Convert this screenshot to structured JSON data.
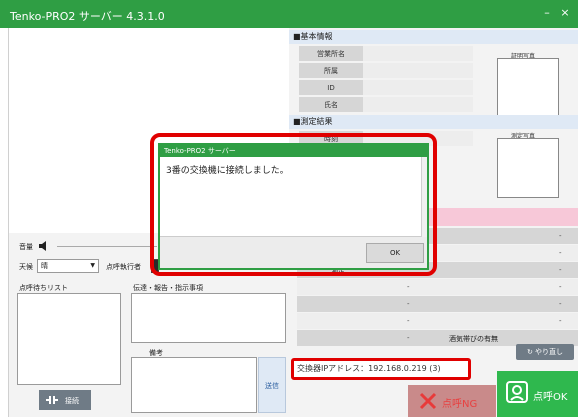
{
  "window": {
    "title": "Tenko-PRO2 サーバー 4.3.1.0",
    "minimize_label": "–",
    "close_label": "×"
  },
  "basic_info": {
    "section_label": "■基本情報",
    "labels": [
      "営業所名",
      "所属",
      "ID",
      "氏名"
    ],
    "photo_label": "証明写真"
  },
  "measurement": {
    "section_label": "■測定結果",
    "row_label": "時刻",
    "photo_label": "測定写真"
  },
  "results_grid": {
    "dashes": [
      "-",
      "-",
      "-",
      "-",
      "-",
      "-",
      "-",
      "-",
      "-",
      "-"
    ],
    "inspection_label": "点呼執行者",
    "cell_label": "測定",
    "alcohol_label": "酒気帯びの有無",
    "redo_label": "やり直し"
  },
  "left_panel": {
    "volume_label": "音量",
    "weather_label": "天候",
    "weather_value": "晴",
    "inspector_label": "点呼執行者",
    "waiting_list_label": "点呼待ちリスト",
    "instructions_label": "伝達・報告・指示事項",
    "remarks_label": "備考",
    "send_label": "送信",
    "connect_label": "接続"
  },
  "status": {
    "ip_text": "交換器IPアドレス：192.168.0.219 (3)"
  },
  "actions": {
    "ng_label": "点呼NG",
    "ok_label": "点呼OK"
  },
  "dialog": {
    "title": "Tenko-PRO2 サーバー",
    "message": "3番の交換機に接続しました。",
    "ok_label": "OK"
  },
  "colors": {
    "accent_green": "#2f9e44",
    "highlight_red": "#e00000",
    "ok_green": "#2fb84e"
  }
}
